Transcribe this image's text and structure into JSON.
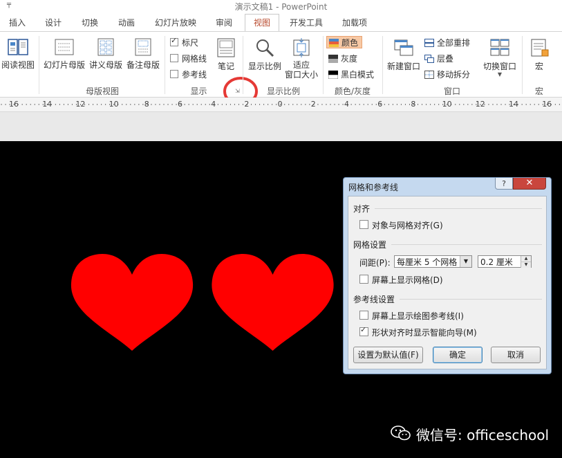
{
  "window": {
    "title": "演示文稿1 - PowerPoint",
    "quick_access": "╤"
  },
  "tabs": [
    "插入",
    "设计",
    "切换",
    "动画",
    "幻灯片放映",
    "审阅",
    "视图",
    "开发工具",
    "加载项"
  ],
  "active_tab": "视图",
  "ribbon": {
    "reading_view": "阅读视图",
    "master_views": {
      "slide_master": "幻灯片母版",
      "handout_master": "讲义母版",
      "notes_master": "备注母版",
      "group_label": "母版视图"
    },
    "show": {
      "ruler": "标尺",
      "gridlines": "网格线",
      "guides": "参考线",
      "notes": "笔记",
      "group_label": "显示",
      "ruler_checked": true,
      "gridlines_checked": false,
      "guides_checked": false
    },
    "zoom": {
      "zoom": "显示比例",
      "fit_window_line1": "适应",
      "fit_window_line2": "窗口大小",
      "group_label": "显示比例"
    },
    "color": {
      "color": "颜色",
      "grayscale": "灰度",
      "black_white": "黑白模式",
      "group_label": "颜色/灰度"
    },
    "window": {
      "new_window": "新建窗口",
      "arrange_all": "全部重排",
      "cascade": "层叠",
      "move_split": "移动拆分",
      "switch_windows": "切换窗口",
      "group_label": "窗口"
    },
    "macros": {
      "macros": "宏",
      "group_label": "宏"
    }
  },
  "ruler_labels": [
    "16",
    "14",
    "12",
    "10",
    "8",
    "6",
    "4",
    "2",
    "0",
    "2",
    "4",
    "6",
    "8",
    "10",
    "12",
    "14",
    "16"
  ],
  "dialog": {
    "title": "网格和参考线",
    "help": "?",
    "close": "✕",
    "snap_section": "对齐",
    "snap_to_grid": "对象与网格对齐(G)",
    "snap_checked": false,
    "grid_section": "网格设置",
    "spacing_label": "间距(P):",
    "spacing_select": "每厘米 5 个网格",
    "spacing_value": "0.2 厘米",
    "display_grid": "屏幕上显示网格(D)",
    "display_grid_checked": false,
    "guide_section": "参考线设置",
    "display_guides": "屏幕上显示绘图参考线(I)",
    "display_guides_checked": false,
    "smart_guides": "形状对齐时显示智能向导(M)",
    "smart_guides_checked": true,
    "set_default": "设置为默认值(F)",
    "ok": "确定",
    "cancel": "取消"
  },
  "colors": {
    "heart": "#ff0000",
    "slide_bg": "#000000",
    "highlight_circle": "#e53935",
    "active_tab": "#b7472a"
  },
  "watermark": "微信号: officeschool"
}
